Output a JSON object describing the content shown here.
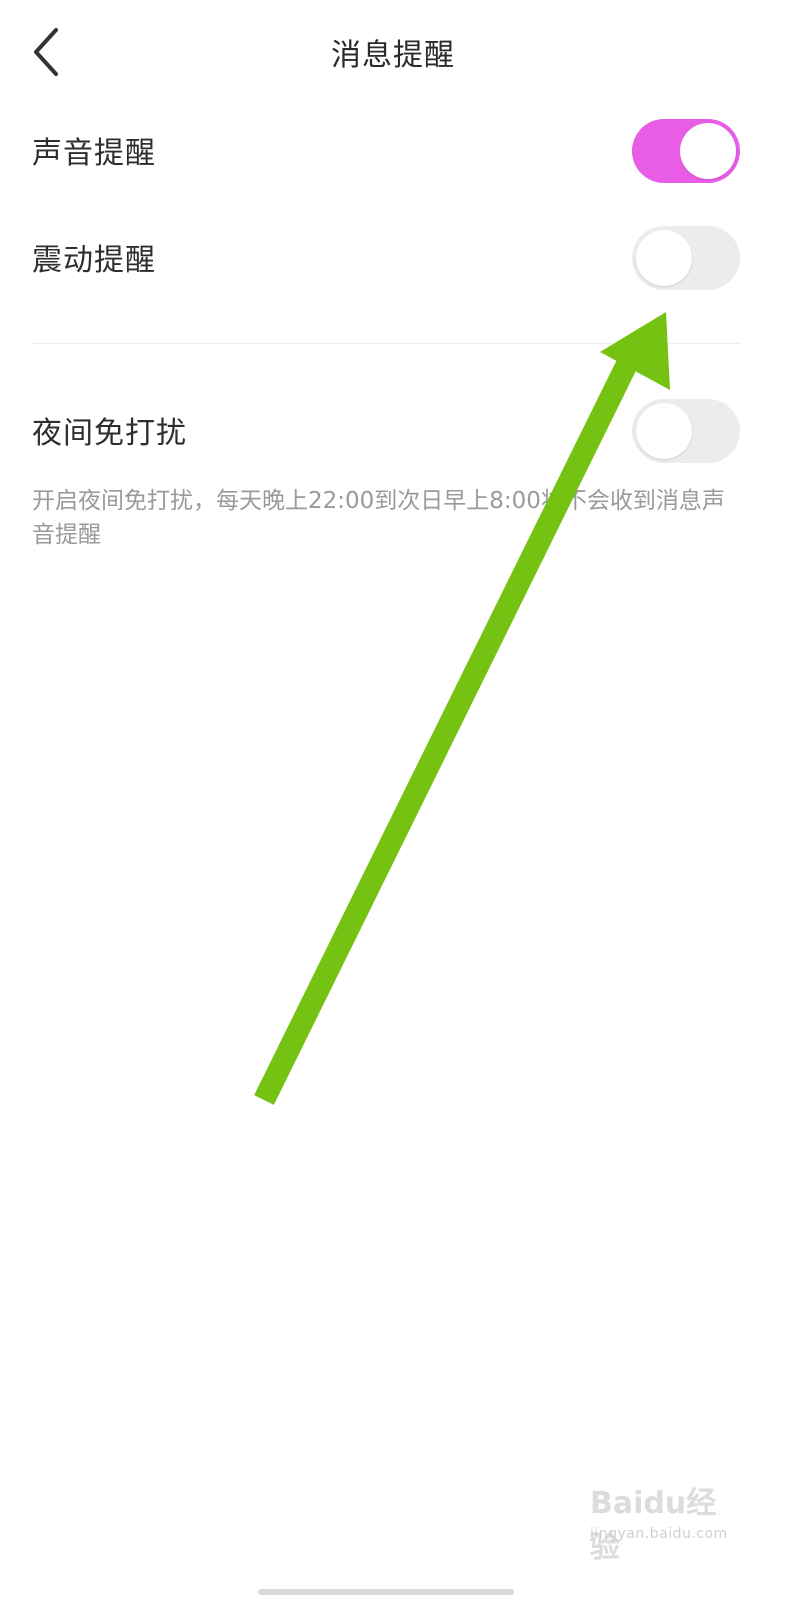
{
  "header": {
    "title": "消息提醒",
    "back_icon": "chevron-left-icon"
  },
  "settings": [
    {
      "label": "声音提醒",
      "enabled": true
    },
    {
      "label": "震动提醒",
      "enabled": false
    },
    {
      "label": "夜间免打扰",
      "enabled": false
    }
  ],
  "night_mode_hint": "开启夜间免打扰，每天晚上22:00到次日早上8:00将不会收到消息声音提醒",
  "watermark": {
    "logo_text": "Baidu经验",
    "url_text": "jingyan.baidu.com"
  },
  "colors": {
    "toggle_on": "#e95de6",
    "toggle_off": "#ececec",
    "annotation_arrow": "#76c212"
  }
}
